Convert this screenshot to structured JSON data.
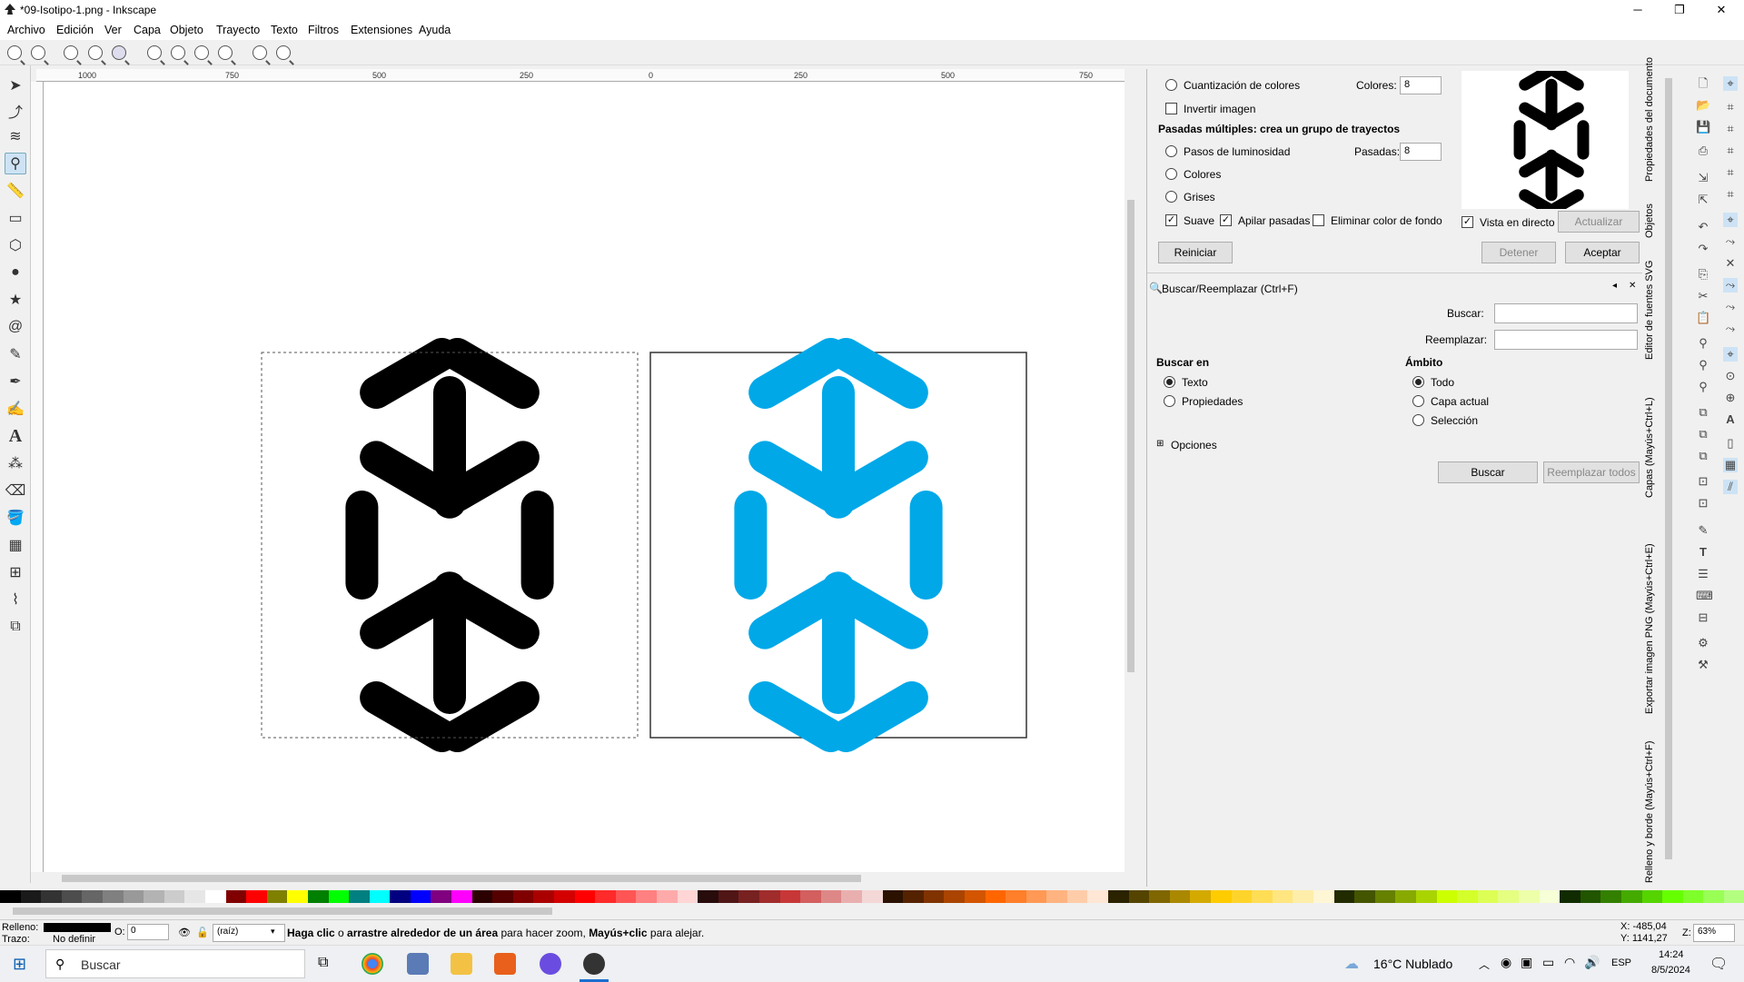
{
  "window": {
    "title": "*09-Isotipo-1.png - Inkscape",
    "min_icon": "minimize-icon",
    "max_icon": "maximize-icon",
    "close_icon": "close-icon",
    "min_glyph": "─",
    "max_glyph": "❐",
    "close_glyph": "✕"
  },
  "menu": [
    "Archivo",
    "Edición",
    "Ver",
    "Capa",
    "Objeto",
    "Trayecto",
    "Texto",
    "Filtros",
    "Extensiones",
    "Ayuda"
  ],
  "ruler": {
    "h_ticks": [
      "1000",
      "750",
      "500",
      "250",
      "0",
      "250",
      "500",
      "750"
    ]
  },
  "colors": {
    "logo_black": "#000000",
    "logo_blue": "#00a8e8"
  },
  "trace": {
    "quant_label": "Cuantización de colores",
    "colors_label": "Colores:",
    "colors_value": "8",
    "invert_label": "Invertir imagen",
    "multi_label": "Pasadas múltiples: crea un grupo de trayectos",
    "brightness_steps_label": "Pasos de luminosidad",
    "passes_label": "Pasadas:",
    "passes_value": "8",
    "colors_option": "Colores",
    "grays_option": "Grises",
    "smooth_label": "Suave",
    "stack_label": "Apilar pasadas",
    "remove_bg_label": "Eliminar color de fondo",
    "live_preview_label": "Vista en directo",
    "update_button": "Actualizar",
    "reset_button": "Reiniciar",
    "stop_button": "Detener",
    "accept_button": "Aceptar"
  },
  "find": {
    "title": "Buscar/Reemplazar (Ctrl+F)",
    "search_label": "Buscar:",
    "search_value": "",
    "replace_label": "Reemplazar:",
    "replace_value": "",
    "search_in_label": "Buscar en",
    "text_option": "Texto",
    "properties_option": "Propiedades",
    "scope_label": "Ámbito",
    "all_option": "Todo",
    "current_layer_option": "Capa actual",
    "selection_option": "Selección",
    "options_label": "Opciones",
    "find_button": "Buscar",
    "replace_all_button": "Reemplazar todos"
  },
  "vtabs": [
    "Propiedades del documento",
    "Objetos",
    "Editor de fuentes SVG",
    "Capas (Mayús+Ctrl+L)",
    "Exportar imagen PNG (Mayús+Ctrl+E)",
    "Relleno y borde (Mayús+Ctrl+F)"
  ],
  "status": {
    "fill_label": "Relleno:",
    "stroke_label": "Trazo:",
    "stroke_value": "No definir",
    "opacity_label": "O:",
    "opacity_value": "0",
    "layer_value": "(raíz)",
    "message_bold1": "Haga clic",
    "message_t1": " o ",
    "message_bold2": "arrastre alrededor de un área",
    "message_t2": " para hacer zoom, ",
    "message_bold3": "Mayús+clic",
    "message_t3": " para alejar.",
    "x_coord": "X: -485,04",
    "y_coord": "Y: 1141,27",
    "zoom_label": "Z:",
    "zoom_value": "63%"
  },
  "taskbar": {
    "search_placeholder": "Buscar",
    "weather": "16°C  Nublado",
    "lang": "ESP",
    "time": "14:24",
    "date": "8/5/2024"
  }
}
